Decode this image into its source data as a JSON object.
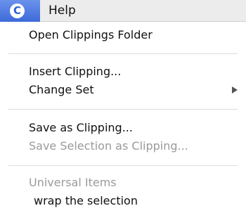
{
  "menubar": {
    "app_icon_letter": "C",
    "help_label": "Help"
  },
  "menu": {
    "open_folder": "Open Clippings Folder",
    "insert_clipping": "Insert Clipping...",
    "change_set": "Change Set",
    "save_as_clipping": "Save as Clipping...",
    "save_selection": "Save Selection as Clipping...",
    "universal_items": "Universal Items",
    "wrap_selection": "wrap the selection"
  }
}
